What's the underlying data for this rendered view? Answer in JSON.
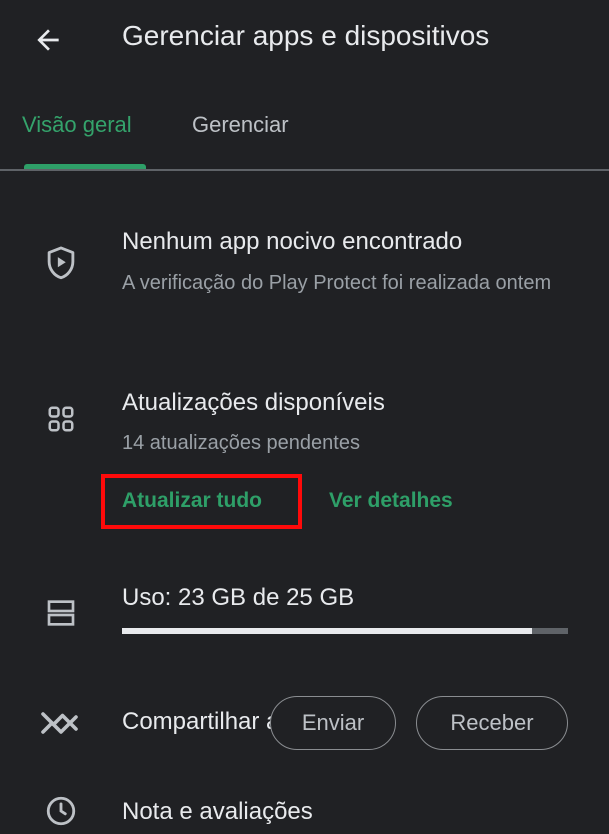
{
  "header": {
    "title": "Gerenciar apps e dispositivos",
    "back_icon": "arrow-back-icon"
  },
  "tabs": [
    {
      "label": "Visão geral",
      "active": true
    },
    {
      "label": "Gerenciar",
      "active": false
    }
  ],
  "protect": {
    "icon": "shield-play-icon",
    "title": "Nenhum app nocivo encontrado",
    "subtitle": "A verificação do Play Protect foi realizada ontem"
  },
  "updates": {
    "icon": "apps-grid-icon",
    "title": "Atualizações disponíveis",
    "subtitle": "14 atualizações pendentes",
    "update_all_label": "Atualizar tudo",
    "details_label": "Ver detalhes"
  },
  "storage": {
    "icon": "storage-icon",
    "title": "Uso: 23 GB de 25 GB",
    "used_fraction": 0.92
  },
  "share": {
    "icon": "nearby-share-icon",
    "title": "Compartilhar apps",
    "send_label": "Enviar",
    "receive_label": "Receber"
  },
  "next_item": {
    "icon": "clock-icon",
    "title": "Nota e avaliações"
  },
  "colors": {
    "background": "#202124",
    "accent": "#2e9f68",
    "highlight": "#ff0a0a",
    "primary_text": "#e8eaed",
    "secondary_text": "#9aa0a6"
  }
}
